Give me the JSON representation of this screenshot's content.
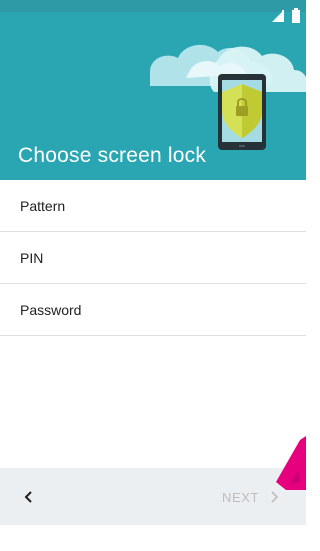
{
  "header": {
    "title": "Choose screen lock",
    "illustration_icon": "tablet-shield-lock-icon",
    "colors": {
      "header_bg": "#2aa6b3",
      "shield": "#d4e157"
    }
  },
  "status_bar": {
    "icons": [
      "signal-icon",
      "battery-icon"
    ]
  },
  "options": [
    {
      "label": "Pattern"
    },
    {
      "label": "PIN"
    },
    {
      "label": "Password"
    }
  ],
  "navigation": {
    "back_icon": "chevron-left-icon",
    "next_label": "NEXT",
    "next_icon": "chevron-right-icon",
    "next_enabled": false
  },
  "overlay": {
    "annotation_icon": "pink-arrow-icon",
    "annotation_color": "#e6007e"
  }
}
